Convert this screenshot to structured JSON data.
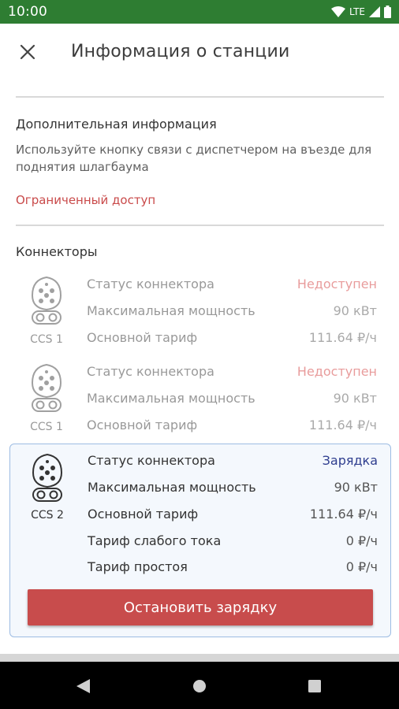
{
  "status_bar": {
    "time": "10:00",
    "network": "LTE"
  },
  "header": {
    "title": "Информация о станции"
  },
  "additional_info": {
    "title": "Дополнительная информация",
    "text": "Используйте кнопку связи с диспетчером на въезде для поднятия шлагбаума",
    "restricted_link": "Ограниченный доступ"
  },
  "connectors_section": {
    "title": "Коннекторы",
    "connectors": [
      {
        "type": "CCS 1",
        "state": "inactive",
        "rows": [
          {
            "label": "Статус коннектора",
            "value": "Недоступен"
          },
          {
            "label": "Максимальная мощность",
            "value": "90 кВт"
          },
          {
            "label": "Основной тариф",
            "value": "111.64 ₽/ч"
          }
        ]
      },
      {
        "type": "CCS 1",
        "state": "inactive",
        "rows": [
          {
            "label": "Статус коннектора",
            "value": "Недоступен"
          },
          {
            "label": "Максимальная мощность",
            "value": "90 кВт"
          },
          {
            "label": "Основной тариф",
            "value": "111.64 ₽/ч"
          }
        ]
      },
      {
        "type": "CCS 2",
        "state": "active",
        "rows": [
          {
            "label": "Статус коннектора",
            "value": "Зарядка"
          },
          {
            "label": "Максимальная мощность",
            "value": "90 кВт"
          },
          {
            "label": "Основной тариф",
            "value": "111.64 ₽/ч"
          },
          {
            "label": "Тариф слабого тока",
            "value": "0 ₽/ч"
          },
          {
            "label": "Тариф простоя",
            "value": "0 ₽/ч"
          }
        ],
        "stop_button": "Остановить зарядку"
      }
    ]
  },
  "icons": {
    "close": "close-icon",
    "plug": "ccs-plug-icon",
    "nav_back": "back-triangle-icon",
    "nav_home": "home-circle-icon",
    "nav_recents": "recents-square-icon"
  },
  "colors": {
    "status_bar": "#2e7d32",
    "unavailable": "#d23a3a",
    "charging": "#2f3e8f",
    "stop_button": "#c84c4c",
    "active_border": "#9dbce3"
  }
}
